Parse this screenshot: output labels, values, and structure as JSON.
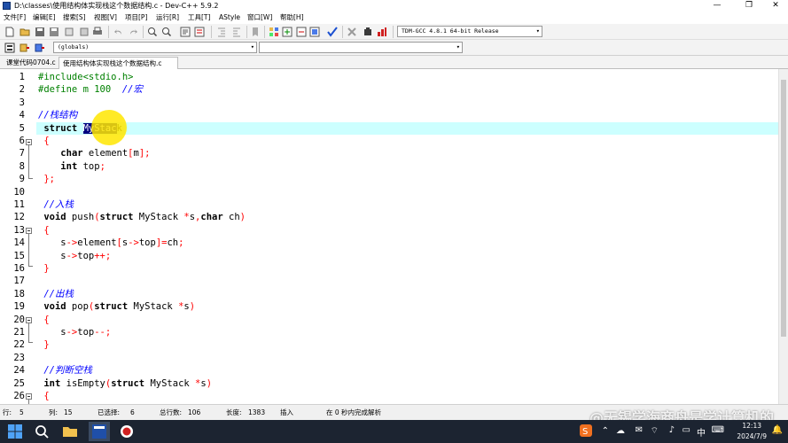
{
  "window": {
    "title": "D:\\classes\\使用结构体实现栈这个数据结构.c - Dev-C++ 5.9.2",
    "minimize": "—",
    "maximize": "❐",
    "close": "✕"
  },
  "menu": [
    "文件[F]",
    "编辑[E]",
    "搜索[S]",
    "视图[V]",
    "项目[P]",
    "运行[R]",
    "工具[T]",
    "AStyle",
    "窗口[W]",
    "帮助[H]"
  ],
  "toolbar": {
    "compiler": "TDM-GCC 4.8.1 64-bit Release",
    "scope": "(globals)"
  },
  "tabs": [
    {
      "label": "课堂代码0704.c",
      "active": false
    },
    {
      "label": "使用结构体实现栈这个数据结构.c",
      "active": true
    }
  ],
  "editor": {
    "line_numbers": [
      "1",
      "2",
      "3",
      "4",
      "5",
      "6",
      "7",
      "8",
      "9",
      "10",
      "11",
      "12",
      "13",
      "14",
      "15",
      "16",
      "17",
      "18",
      "19",
      "20",
      "21",
      "22",
      "23",
      "24",
      "25",
      "26"
    ],
    "current_line": 5,
    "selected_text": "MyStac"
  },
  "status": {
    "row_label": "行:",
    "row": "5",
    "col_label": "列:",
    "col": "15",
    "selected_label": "已选择:",
    "selected": "6",
    "total_label": "总行数:",
    "total": "106",
    "length_label": "长度:",
    "length": "1383",
    "mode": "插入",
    "parse": "在 0 秒内完成解析"
  },
  "watermark": "@无锡学海商舟是学计算机的",
  "taskbar": {
    "time": "12:13",
    "date": "2024/7/9",
    "ime": "中"
  },
  "colors": {
    "keyword": "#000000",
    "preprocessor": "#008000",
    "comment": "#0000ff",
    "symbol": "#ff0000",
    "current_line": "#ccffff",
    "selection": "#000080"
  }
}
